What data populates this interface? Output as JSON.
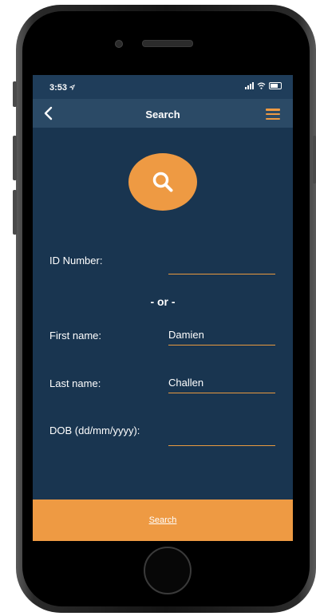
{
  "status_bar": {
    "time": "3:53"
  },
  "nav": {
    "title": "Search"
  },
  "form": {
    "id_number": {
      "label": "ID Number:",
      "value": ""
    },
    "separator": "- or -",
    "first_name": {
      "label": "First name:",
      "value": "Damien"
    },
    "last_name": {
      "label": "Last name:",
      "value": "Challen"
    },
    "dob": {
      "label": "DOB (dd/mm/yyyy):",
      "value": ""
    }
  },
  "footer": {
    "search_label": "Search"
  },
  "colors": {
    "accent": "#ee9a43",
    "background": "#193550",
    "nav_bar": "#2b4a66",
    "status_bar": "#1f3d5a"
  },
  "icons": [
    "back-chevron-icon",
    "hamburger-menu-icon",
    "search-magnifier-icon",
    "location-arrow-icon",
    "signal-icon",
    "wifi-icon",
    "battery-icon"
  ]
}
